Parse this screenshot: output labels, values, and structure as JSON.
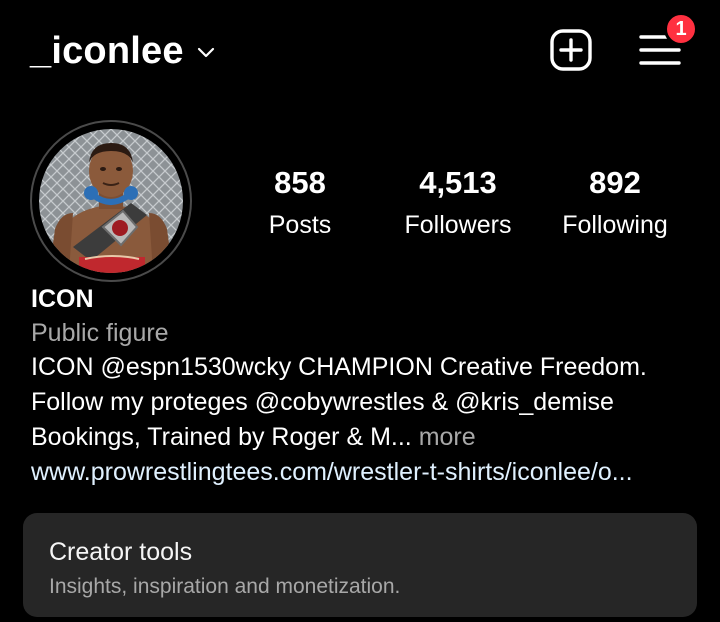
{
  "header": {
    "username": "_iconlee",
    "notification_count": "1"
  },
  "icons": {
    "username_dropdown": "chevron-down-icon",
    "create": "plus-square-icon",
    "menu": "hamburger-menu-icon"
  },
  "profile": {
    "avatar_alt": "profile photo"
  },
  "stats": [
    {
      "value": "858",
      "label": "Posts"
    },
    {
      "value": "4,513",
      "label": "Followers"
    },
    {
      "value": "892",
      "label": "Following"
    }
  ],
  "bio": {
    "name": "ICON",
    "category": "Public figure",
    "line1": "ICON @espn1530wcky CHAMPION Creative Freedom.",
    "line2": "Follow my proteges @cobywrestles & @kris_demise",
    "line3": "Bookings, Trained by Roger & M...",
    "more_label": "more",
    "website": "www.prowrestlingtees.com/wrestler-t-shirts/iconlee/o..."
  },
  "creator_tools": {
    "title": "Creator tools",
    "subtitle": "Insights, inspiration and monetization."
  },
  "colors": {
    "background": "#000000",
    "badge": "#ff3040",
    "card": "#262626",
    "secondary_text": "#a8a8a8"
  }
}
